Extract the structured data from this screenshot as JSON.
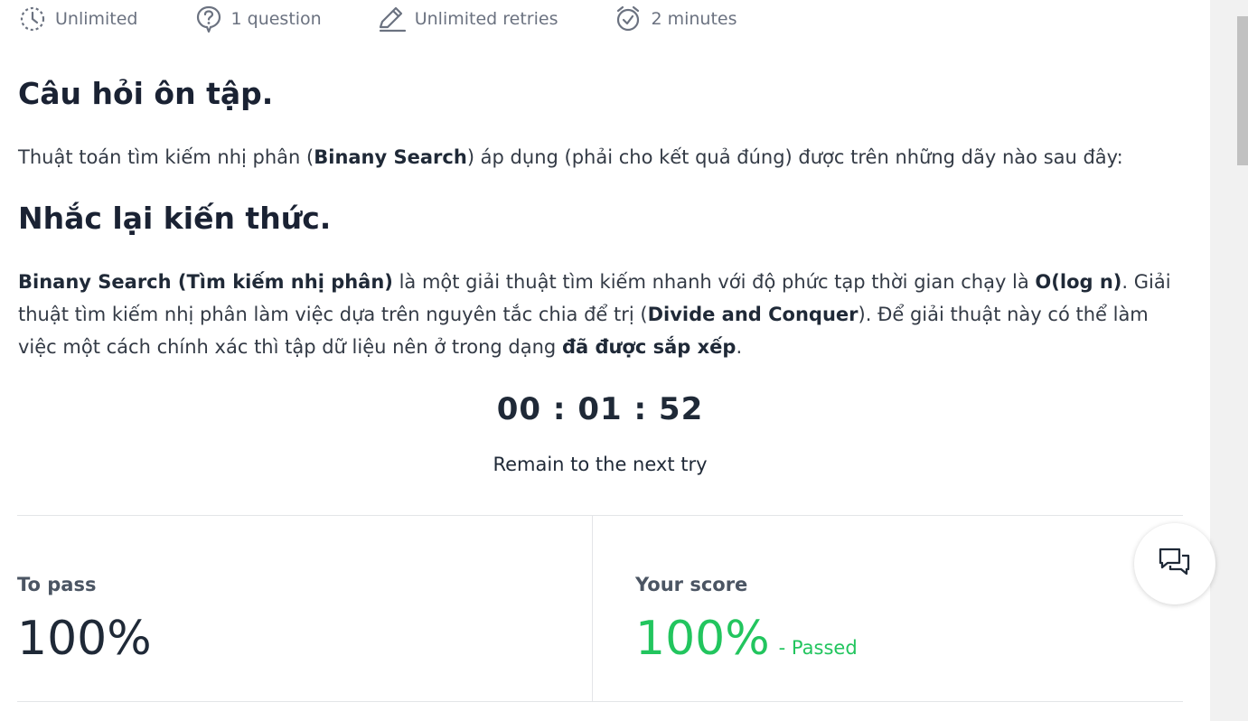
{
  "meta": [
    {
      "icon": "clock-dashed-icon",
      "label": "Unlimited"
    },
    {
      "icon": "question-bubble-icon",
      "label": "1 question"
    },
    {
      "icon": "pencil-icon",
      "label": "Unlimited retries"
    },
    {
      "icon": "alarm-clock-icon",
      "label": "2 minutes"
    }
  ],
  "question": {
    "title": "Câu hỏi ôn tập.",
    "text_before": "Thuật toán tìm kiếm nhị phân (",
    "text_bold": "Binany Search",
    "text_after": ") áp dụng (phải cho kết quả đúng) được trên những dãy nào sau đây:"
  },
  "recap": {
    "title": "Nhắc lại kiến thức.",
    "bold1": "Binany Search (Tìm kiếm nhị phân)",
    "text1": " là một giải thuật tìm kiếm nhanh với độ phức tạp thời gian chạy là ",
    "bold2": "O(log n)",
    "text2": ". Giải thuật tìm kiếm nhị phân làm việc dựa trên nguyên tắc chia để trị (",
    "bold3": "Divide and Conquer",
    "text3": "). Để giải thuật này có thể làm việc một cách chính xác thì tập dữ liệu nên ở trong dạng ",
    "bold4": "đã được sắp xếp",
    "text4": "."
  },
  "timer": {
    "value": "00 : 01 : 52",
    "caption": "Remain to the next try"
  },
  "scores": {
    "to_pass_label": "To pass",
    "to_pass_value": "100%",
    "your_score_label": "Your score",
    "your_score_value": "100%",
    "status": "- Passed"
  },
  "colors": {
    "pass_green": "#22c55e",
    "text_dark": "#1f2937",
    "muted": "#6b7280"
  },
  "chat": {
    "icon": "chat-bubbles-icon"
  }
}
